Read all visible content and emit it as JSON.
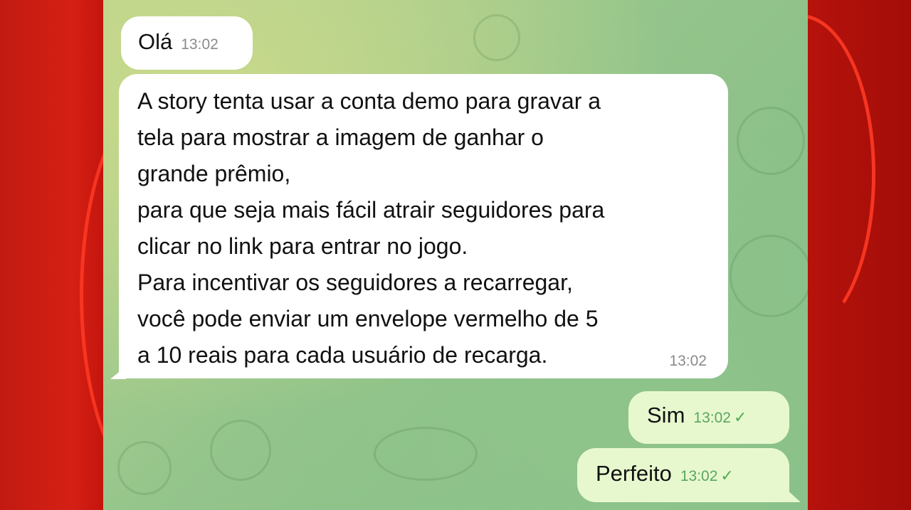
{
  "messages": [
    {
      "direction": "incoming",
      "text": "Olá",
      "time": "13:02"
    },
    {
      "direction": "incoming",
      "text": "A story tenta usar a conta demo para gravar a\ntela para mostrar a imagem de ganhar o\ngrande prêmio,\npara que seja mais fácil atrair seguidores para\nclicar no link para entrar no jogo.\nPara incentivar os seguidores a recarregar,\nvocê pode enviar um envelope vermelho de 5\na 10 reais para cada usuário de recarga.",
      "time": "13:02"
    },
    {
      "direction": "outgoing",
      "text": "Sim",
      "time": "13:02",
      "status": "✓"
    },
    {
      "direction": "outgoing",
      "text": "Perfeito",
      "time": "13:02",
      "status": "✓"
    }
  ],
  "colors": {
    "frame": "#c8160f",
    "incoming_bubble": "#ffffff",
    "outgoing_bubble": "#e7f8cf",
    "read_check": "#4fae4e"
  }
}
